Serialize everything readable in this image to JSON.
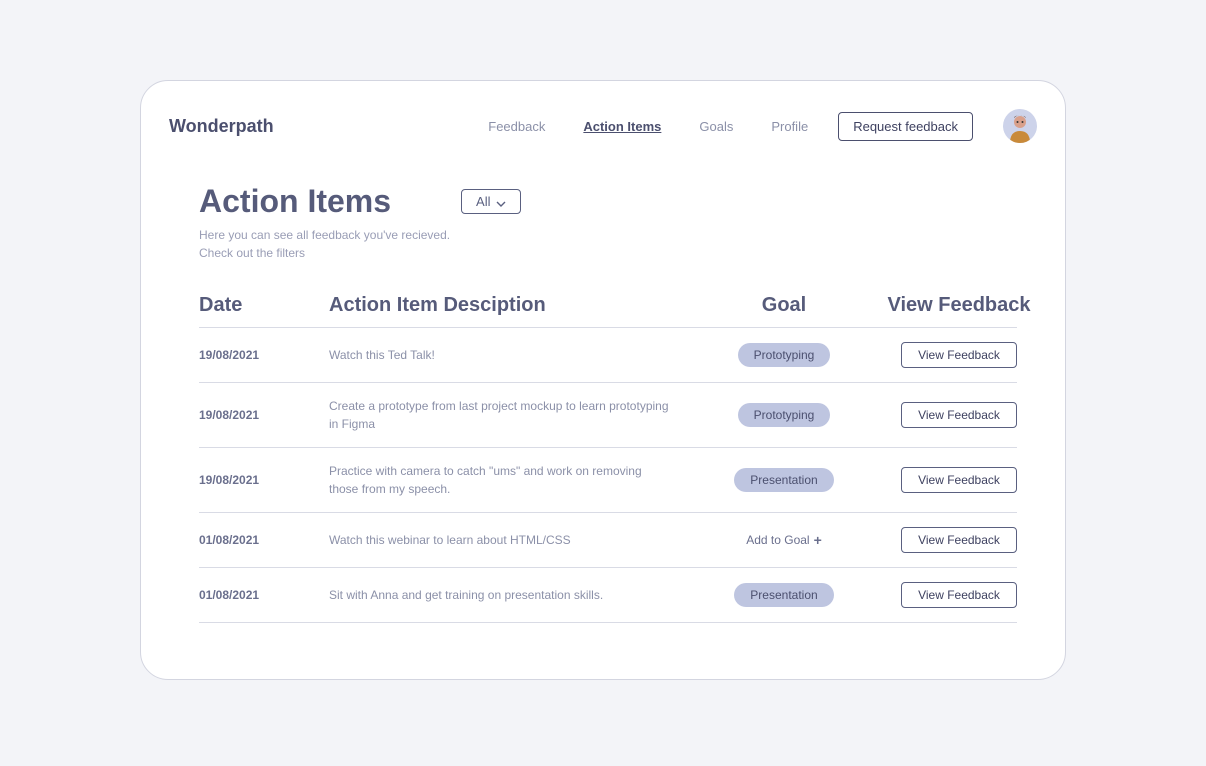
{
  "brand": "Wonderpath",
  "nav": {
    "feedback": "Feedback",
    "action_items": "Action Items",
    "goals": "Goals",
    "profile": "Profile"
  },
  "request_feedback": "Request feedback",
  "page": {
    "title": "Action Items",
    "subtitle": "Here you can see all feedback you've recieved. Check out the filters",
    "filter_label": "All"
  },
  "columns": {
    "date": "Date",
    "desc": "Action Item Desciption",
    "goal": "Goal",
    "view": "View Feedback"
  },
  "add_to_goal": "Add to Goal",
  "view_feedback_btn": "View Feedback",
  "rows": [
    {
      "date": "19/08/2021",
      "desc": "Watch this Ted Talk!",
      "goal": "Prototyping"
    },
    {
      "date": "19/08/2021",
      "desc": "Create a prototype from last project mockup to learn prototyping in Figma",
      "goal": "Prototyping"
    },
    {
      "date": "19/08/2021",
      "desc": "Practice with camera to catch \"ums\" and work on removing those from my speech.",
      "goal": "Presentation"
    },
    {
      "date": "01/08/2021",
      "desc": "Watch this webinar to learn about HTML/CSS",
      "goal": null
    },
    {
      "date": "01/08/2021",
      "desc": "Sit with Anna and get training on presentation skills.",
      "goal": "Presentation"
    }
  ]
}
